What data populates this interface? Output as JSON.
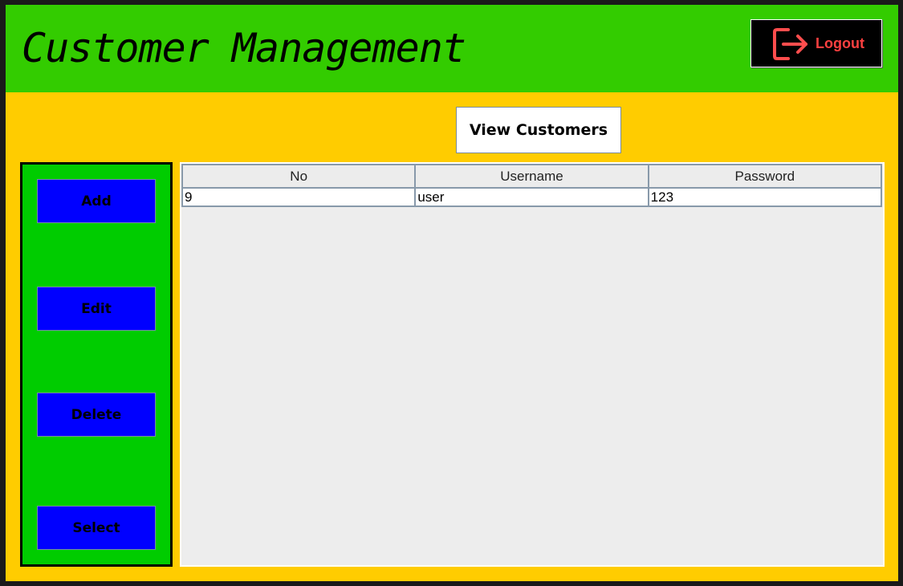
{
  "header": {
    "title": "Customer Management",
    "logout_label": "Logout",
    "logout_icon": "logout-icon"
  },
  "main": {
    "view_customers_label": "View Customers"
  },
  "sidebar": {
    "buttons": [
      {
        "label": "Add"
      },
      {
        "label": "Edit"
      },
      {
        "label": "Delete"
      },
      {
        "label": "Select"
      }
    ]
  },
  "table": {
    "columns": [
      "No",
      "Username",
      "Password"
    ],
    "rows": [
      [
        "9",
        "user",
        "123"
      ]
    ]
  },
  "colors": {
    "header_bg": "#33cc00",
    "body_bg": "#ffcc00",
    "sidebar_bg": "#00cc00",
    "button_blue": "#0000ff",
    "logout_text": "#ff4040"
  }
}
